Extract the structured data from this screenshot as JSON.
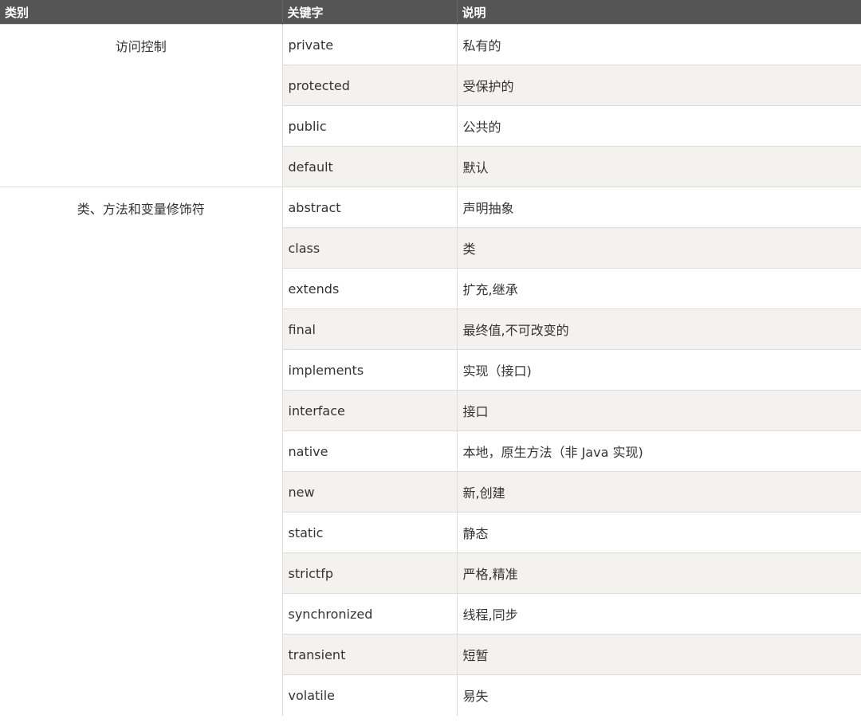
{
  "header": {
    "category": "类别",
    "keyword": "关键字",
    "description": "说明"
  },
  "groups": [
    {
      "category": "访问控制",
      "rows": [
        {
          "keyword": "private",
          "description": "私有的"
        },
        {
          "keyword": "protected",
          "description": "受保护的"
        },
        {
          "keyword": "public",
          "description": "公共的"
        },
        {
          "keyword": "default",
          "description": "默认"
        }
      ]
    },
    {
      "category": "类、方法和变量修饰符",
      "rows": [
        {
          "keyword": "abstract",
          "description": "声明抽象"
        },
        {
          "keyword": "class",
          "description": "类"
        },
        {
          "keyword": "extends",
          "description": "扩充,继承"
        },
        {
          "keyword": "final",
          "description": "最终值,不可改变的"
        },
        {
          "keyword": "implements",
          "description": "实现（接口)"
        },
        {
          "keyword": "interface",
          "description": "接口"
        },
        {
          "keyword": "native",
          "description": "本地，原生方法（非 Java 实现)"
        },
        {
          "keyword": "new",
          "description": "新,创建"
        },
        {
          "keyword": "static",
          "description": "静态"
        },
        {
          "keyword": "strictfp",
          "description": "严格,精准"
        },
        {
          "keyword": "synchronized",
          "description": "线程,同步"
        },
        {
          "keyword": "transient",
          "description": "短暂"
        },
        {
          "keyword": "volatile",
          "description": "易失"
        }
      ]
    }
  ]
}
